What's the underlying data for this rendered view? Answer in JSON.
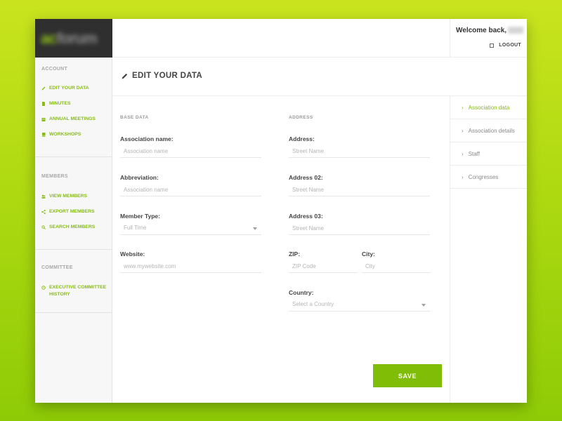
{
  "brand": {
    "logo_text_accent": "ac",
    "logo_text": "forum"
  },
  "header": {
    "welcome": "Welcome back,",
    "logout": "LOGOUT"
  },
  "sidebar": {
    "sections": [
      {
        "heading": "ACCOUNT",
        "items": [
          {
            "label": "EDIT YOUR DATA",
            "icon": "pencil-icon"
          },
          {
            "label": "MINUTES",
            "icon": "document-icon"
          },
          {
            "label": "ANNUAL MEETINGS",
            "icon": "calendar-icon"
          },
          {
            "label": "WORKSHOPS",
            "icon": "book-icon"
          }
        ]
      },
      {
        "heading": "MEMBERS",
        "items": [
          {
            "label": "VIEW MEMBERS",
            "icon": "users-icon"
          },
          {
            "label": "EXPORT MEMBERS",
            "icon": "share-icon"
          },
          {
            "label": "SEARCH MEMBERS",
            "icon": "search-icon"
          }
        ]
      },
      {
        "heading": "COMMITTEE",
        "items": [
          {
            "label": "EXECUTIVE COMMITTEE HISTORY",
            "icon": "history-icon"
          }
        ]
      }
    ]
  },
  "page": {
    "title": "EDIT YOUR DATA"
  },
  "right_panel": {
    "items": [
      {
        "label": "Association data",
        "active": true
      },
      {
        "label": "Association details",
        "active": false
      },
      {
        "label": "Staff",
        "active": false
      },
      {
        "label": "Congresses",
        "active": false
      }
    ]
  },
  "form": {
    "base_data_heading": "BASE DATA",
    "address_heading": "ADDRESS",
    "association_name": {
      "label": "Association name:",
      "placeholder": "Association name",
      "value": ""
    },
    "abbreviation": {
      "label": "Abbreviation:",
      "placeholder": "Association name",
      "value": ""
    },
    "member_type": {
      "label": "Member Type:",
      "selected": "Full Time"
    },
    "website": {
      "label": "Website:",
      "placeholder": "www.mywebsite.com",
      "value": ""
    },
    "address1": {
      "label": "Address:",
      "placeholder": "Street Name",
      "value": ""
    },
    "address2": {
      "label": "Address 02:",
      "placeholder": "Street Name",
      "value": ""
    },
    "address3": {
      "label": "Address 03:",
      "placeholder": "Street Name",
      "value": ""
    },
    "zip": {
      "label": "ZIP:",
      "placeholder": "ZIP Code",
      "value": ""
    },
    "city": {
      "label": "City:",
      "placeholder": "City",
      "value": ""
    },
    "country": {
      "label": "Country:",
      "selected": "Select a Country"
    },
    "save_label": "SAVE"
  },
  "colors": {
    "accent": "#80bd06",
    "background": "#b5dc14"
  }
}
